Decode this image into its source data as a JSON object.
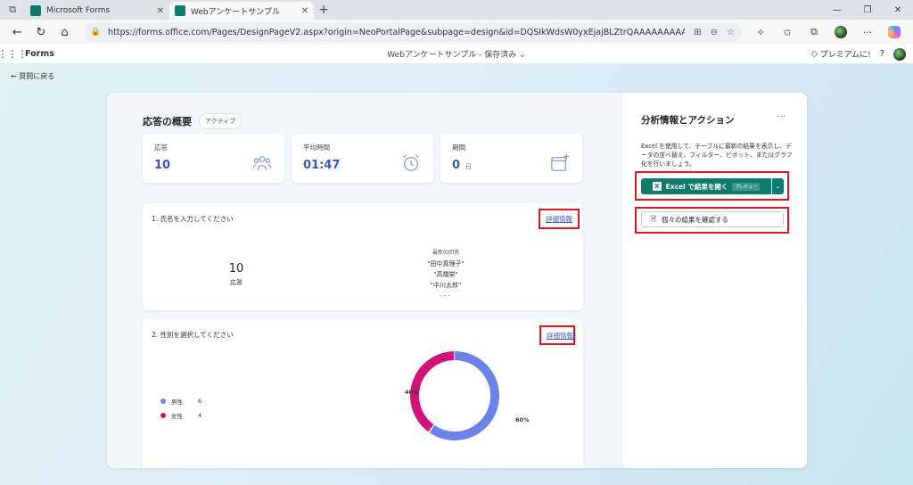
{
  "browser": {
    "tabs": [
      {
        "label": "Microsoft Forms",
        "active": false
      },
      {
        "label": "Webアンケートサンプル",
        "active": true
      }
    ],
    "new_tab": "+",
    "url": "https://forms.office.com/Pages/DesignPageV2.aspx?origin=NeoPortalPage&subpage=design&id=DQSIkWdsW0yxEjajBLZtrQAAAAAAAAAAAANAAcQp--xU..."
  },
  "header": {
    "app_name": "Forms",
    "doc_title": "Webアンケートサンプル",
    "save_status": "保存済み",
    "premium": "プレミアムに!",
    "help": "?"
  },
  "back_link": "← 質問に戻る",
  "summary": {
    "title": "応答の概要",
    "status": "アクティブ",
    "stats": [
      {
        "label": "応答",
        "value": "10",
        "unit": "",
        "icon": "people-icon"
      },
      {
        "label": "平均時間",
        "value": "01:47",
        "unit": "",
        "icon": "alarm-icon"
      },
      {
        "label": "期間",
        "value": "0",
        "unit": "日",
        "icon": "calendar-add-icon"
      }
    ]
  },
  "questions": [
    {
      "title": "1. 氏名を入力してください",
      "detail_label": "詳細情報",
      "count": "10",
      "count_label": "応答",
      "latest_header": "最新の回答",
      "latest": [
        "\"田中真理子\"",
        "\"高橋栄\"",
        "\"中川太郎\""
      ],
      "more": "..."
    },
    {
      "title": "2. 性別を選択してください",
      "detail_label": "詳細情報",
      "legend": [
        {
          "name": "男性",
          "count": "6",
          "color": "#6b83e8"
        },
        {
          "name": "女性",
          "count": "4",
          "color": "#d1127a"
        }
      ]
    }
  ],
  "chart_data": {
    "type": "pie",
    "categories": [
      "男性",
      "女性"
    ],
    "values": [
      6,
      4
    ],
    "labels": [
      "60%",
      "40%"
    ],
    "colors": [
      "#6b83e8",
      "#d1127a"
    ]
  },
  "analysis": {
    "title": "分析情報とアクション",
    "more": "···",
    "description": "Excel を使用して、テーブルに最新の結果を表示し、データの並べ替え、フィルター、ピボット、またはグラフ化を行いましょう。",
    "excel_button": "Excel で結果を開く",
    "excel_badge": "プレビュー",
    "individual_button": "個々の結果を確認する"
  }
}
